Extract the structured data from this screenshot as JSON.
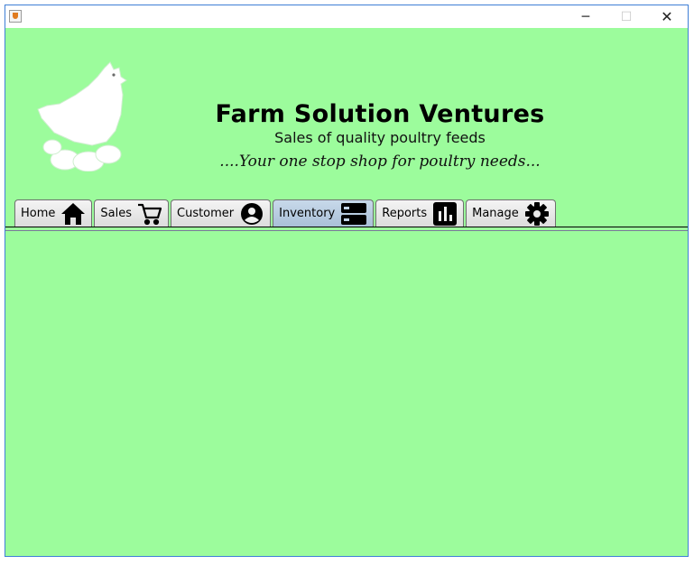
{
  "window": {
    "minimize_glyph": "─",
    "maximize_glyph": "☐",
    "close_glyph": "✕"
  },
  "brand": {
    "title": "Farm Solution Ventures",
    "subtitle": "Sales of quality poultry feeds",
    "tagline": "....Your one stop shop for poultry needs..."
  },
  "tabs": [
    {
      "label": "Home",
      "icon": "home-icon"
    },
    {
      "label": "Sales",
      "icon": "cart-icon"
    },
    {
      "label": "Customer",
      "icon": "user-circle-icon"
    },
    {
      "label": "Inventory",
      "icon": "storage-icon"
    },
    {
      "label": "Reports",
      "icon": "bar-chart-icon"
    },
    {
      "label": "Manage",
      "icon": "gear-icon"
    }
  ],
  "active_tab": "Inventory",
  "colors": {
    "background": "#9cfc9c",
    "active_tab": "#b8cde2",
    "window_border": "#3f7fd6"
  }
}
